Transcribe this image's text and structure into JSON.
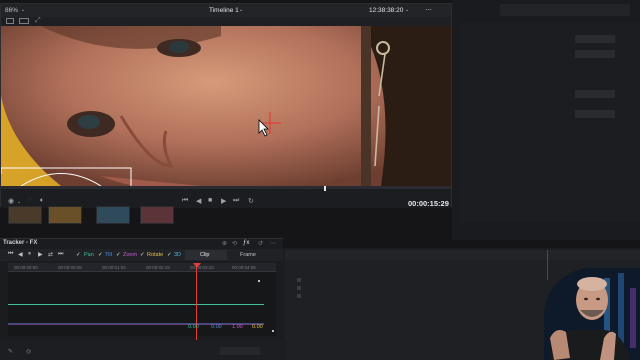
{
  "viewer": {
    "zoom": "86%",
    "timeline_name": "Timeline 1",
    "timecode_top": "12:38:38:20",
    "timecode_bottom": "00:00:15:29",
    "playhead_progress": 0.72
  },
  "tracker": {
    "title": "Tracker - FX",
    "toggles": [
      {
        "label": "Pan",
        "color": "#3fbf9a"
      },
      {
        "label": "Tilt",
        "color": "#4f8de0"
      },
      {
        "label": "Zoom",
        "color": "#c85bd0"
      },
      {
        "label": "Rotate",
        "color": "#e0c14a"
      },
      {
        "label": "3D",
        "color": "#4fb7d0"
      }
    ],
    "modes": [
      "Clip",
      "Frame"
    ],
    "ruler_ticks": [
      "00:00:00:00",
      "00:00:00:25",
      "00:00:01:20",
      "00:00:02:15",
      "00:00:03:10",
      "00:00:04:05"
    ],
    "values": [
      {
        "text": "0.00",
        "color": "#3fbf9a"
      },
      {
        "text": "0.00",
        "color": "#4f8de0"
      },
      {
        "text": "1.00",
        "color": "#c85bd0"
      },
      {
        "text": "0.00",
        "color": "#e0c14a"
      }
    ]
  },
  "icons": {
    "cursor": "arrow-cursor-icon",
    "crosshair": "crosshair-icon"
  },
  "colors": {
    "playhead": "#e0403a",
    "video_bg": "#c9962f"
  }
}
